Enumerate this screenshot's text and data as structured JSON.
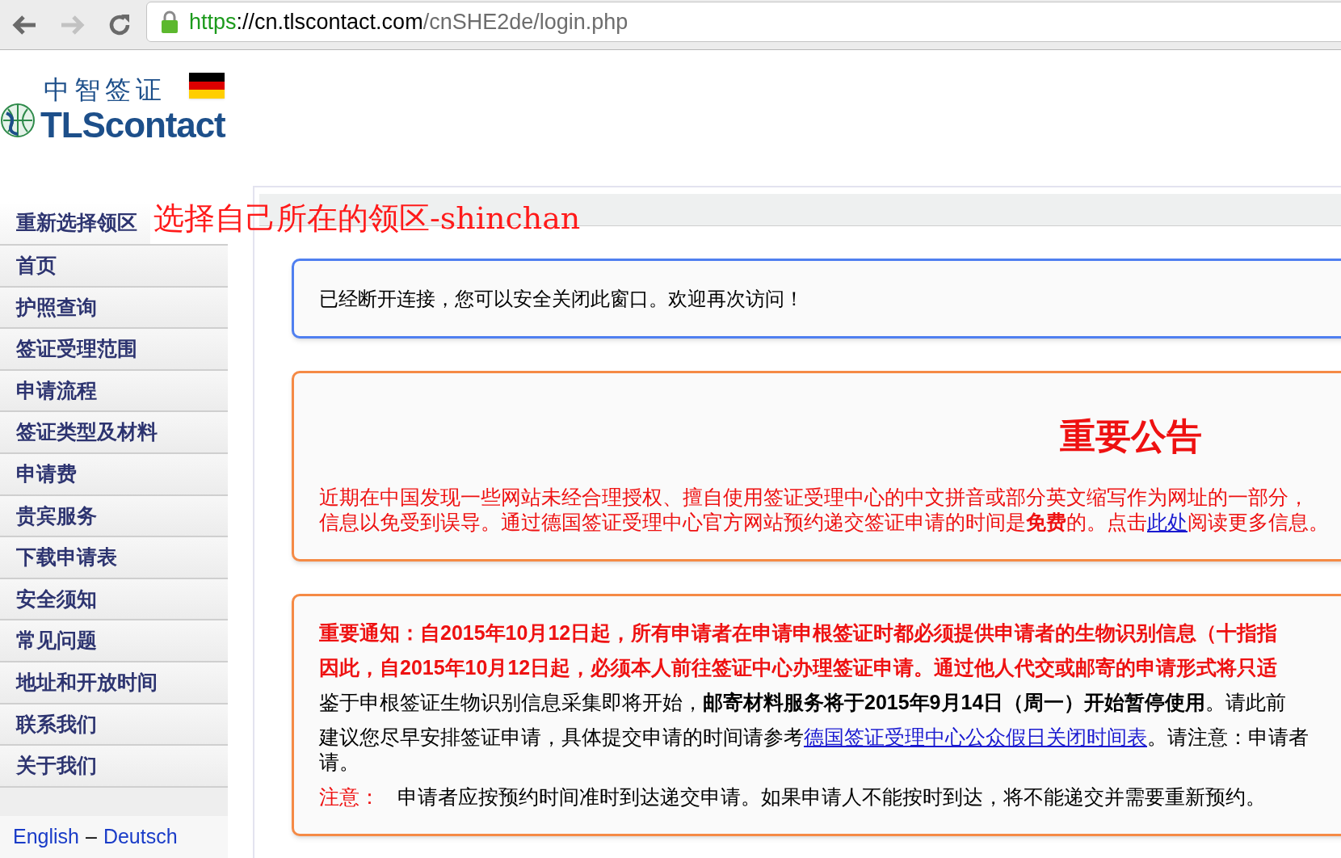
{
  "browser": {
    "url_scheme": "https",
    "url_host": "://cn.tlscontact.com",
    "url_path": "/cnSHE2de/login.php"
  },
  "logo": {
    "chinese": "中智签证",
    "brand": "TLScontact"
  },
  "annotation": "选择自己所在的领区-shinchan",
  "sidebar": {
    "items": [
      {
        "label": "重新选择领区"
      },
      {
        "label": "首页"
      },
      {
        "label": "护照查询"
      },
      {
        "label": "签证受理范围"
      },
      {
        "label": "申请流程"
      },
      {
        "label": "签证类型及材料"
      },
      {
        "label": "申请费"
      },
      {
        "label": "贵宾服务"
      },
      {
        "label": "下载申请表"
      },
      {
        "label": "安全须知"
      },
      {
        "label": "常见问题"
      },
      {
        "label": "地址和开放时间"
      },
      {
        "label": "联系我们"
      },
      {
        "label": "关于我们"
      }
    ],
    "languages": [
      "English",
      "Deutsch"
    ],
    "separator": "–"
  },
  "message": "已经断开连接，您可以安全关闭此窗口。欢迎再次访问！",
  "announcement": {
    "title": "重要公告",
    "lines": [
      "近期在中国发现一些网站未经合理授权、擅自使用签证受理中心的中文拼音或部分英文缩写作为网址的一部分，",
      "信息以免受到误导。通过德国签证受理中心官方网站预约递交签证申请的时间是**免费**的。点击"
    ],
    "link": "此处",
    "after_link": "阅读更多信息。"
  },
  "notice": {
    "red_lines": [
      "重要通知：自2015年10月12日起，所有申请者在申请申根签证时都必须提供申请者的生物识别信息（十指指",
      "因此，自2015年10月12日起，必须本人前往签证中心办理签证申请。通过他人代交或邮寄的申请形式将只适"
    ],
    "line3": "鉴于申根签证生物识别信息采集即将开始，**邮寄材料服务将于2015年9月14日（周一）开始暂停使用**。请此前",
    "line4_before": "建议您尽早安排签证申请，具体提交申请的时间请参考",
    "line4_link": "德国签证受理中心公众假日关闭时间表",
    "line4_after": "。请注意：申请者",
    "line5": "请。",
    "note_label": "注意：",
    "note_text": "申请者应按预约时间准时到达递交申请。如果申请人不能按时到达，将不能递交并需要重新预约。"
  }
}
